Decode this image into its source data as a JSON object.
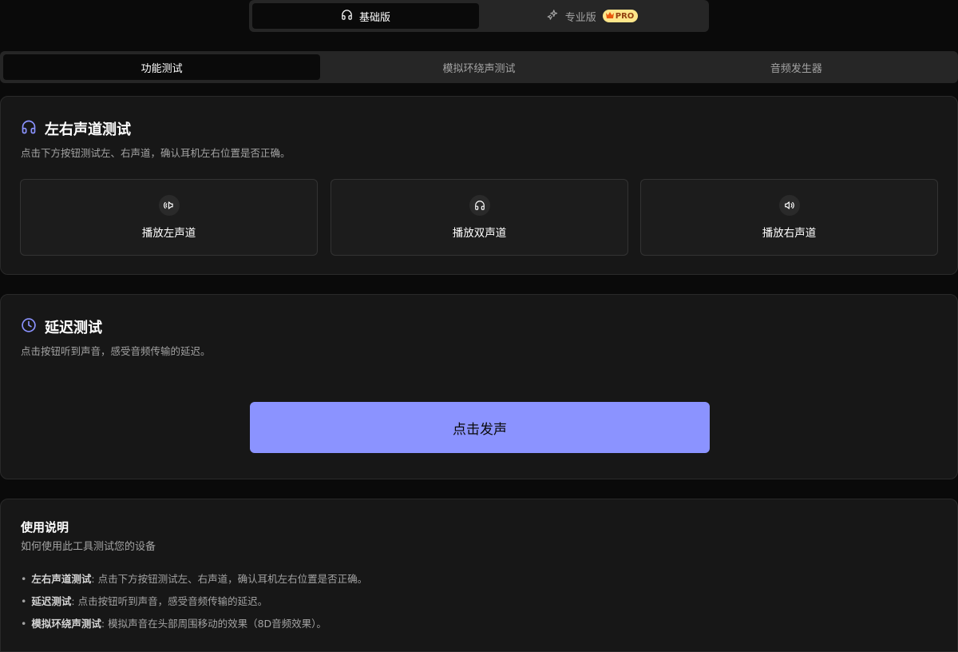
{
  "edition": {
    "basic_label": "基础版",
    "pro_label": "专业版",
    "pro_badge": "PRO"
  },
  "tabs": [
    {
      "label": "功能测试",
      "active": true
    },
    {
      "label": "模拟环绕声测试",
      "active": false
    },
    {
      "label": "音频发生器",
      "active": false
    }
  ],
  "channel_test": {
    "title": "左右声道测试",
    "description": "点击下方按钮测试左、右声道，确认耳机左右位置是否正确。",
    "buttons": [
      {
        "label": "播放左声道",
        "icon": "speaker-left-icon"
      },
      {
        "label": "播放双声道",
        "icon": "headphones-icon"
      },
      {
        "label": "播放右声道",
        "icon": "speaker-right-icon"
      }
    ]
  },
  "latency_test": {
    "title": "延迟测试",
    "description": "点击按钮听到声音，感受音频传输的延迟。",
    "button_label": "点击发声"
  },
  "help": {
    "title": "使用说明",
    "subtitle": "如何使用此工具测试您的设备",
    "items": [
      {
        "term": "左右声道测试",
        "text": ": 点击下方按钮测试左、右声道，确认耳机左右位置是否正确。"
      },
      {
        "term": "延迟测试",
        "text": ": 点击按钮听到声音，感受音频传输的延迟。"
      },
      {
        "term": "模拟环绕声测试",
        "text": ": 模拟声音在头部周围移动的效果（8D音频效果）。"
      }
    ]
  },
  "colors": {
    "accent": "#8b93ff",
    "background": "#0a0a0a",
    "card": "#171717"
  }
}
